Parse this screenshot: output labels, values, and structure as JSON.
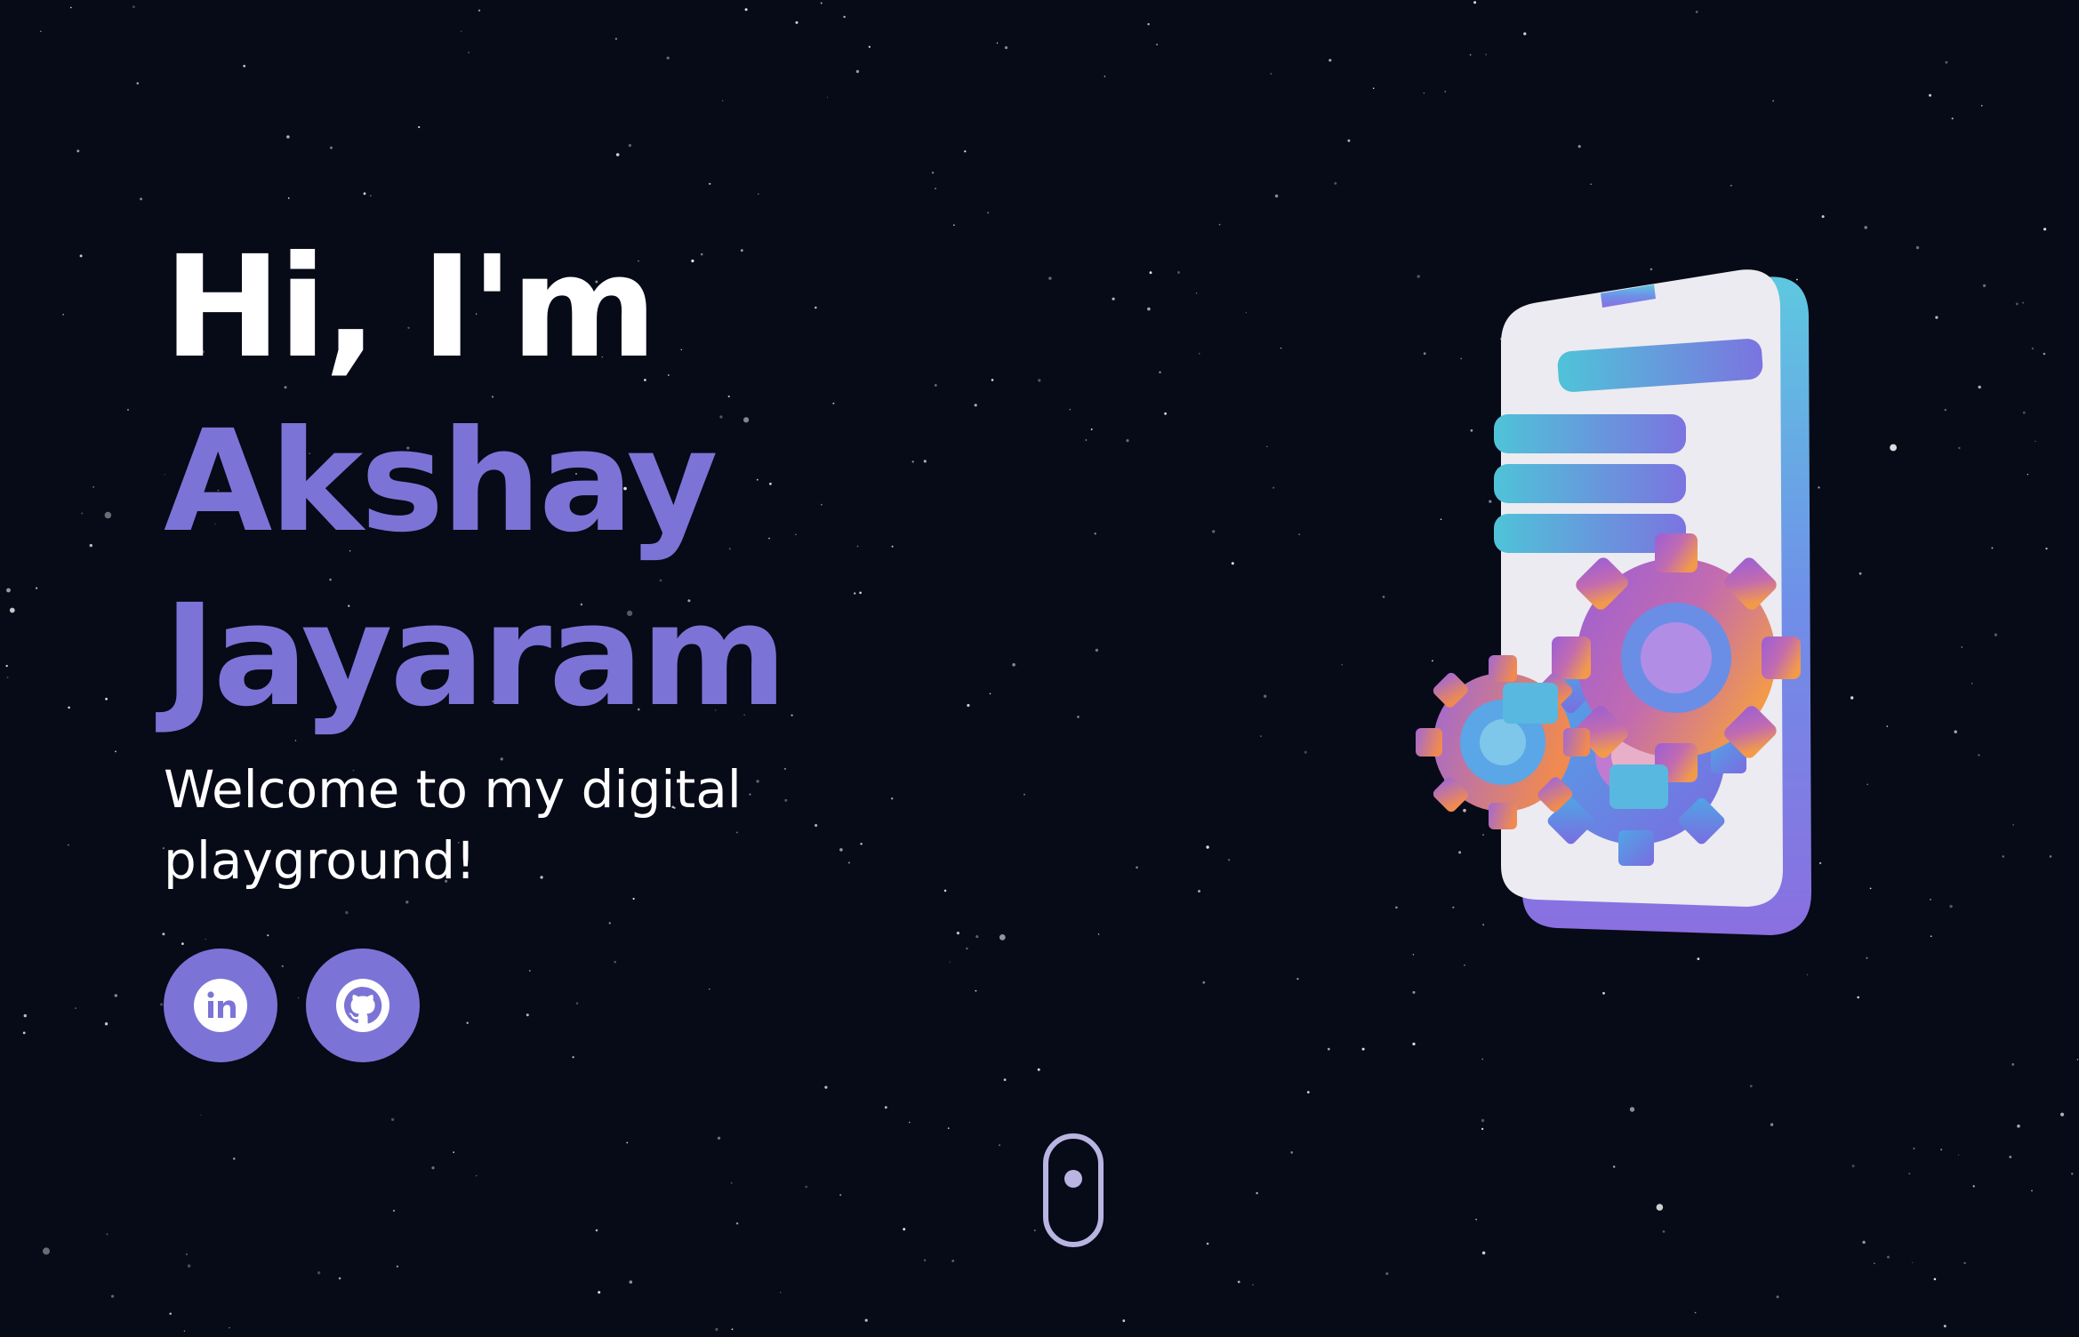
{
  "hero": {
    "greeting": "Hi, I'm",
    "first_name": "Akshay",
    "last_name": "Jayaram",
    "tagline": "Welcome to my digital playground!"
  },
  "socials": [
    {
      "icon": "linkedin-icon"
    },
    {
      "icon": "github-icon"
    }
  ],
  "colors": {
    "background": "#070a17",
    "accent": "#7b74d6",
    "text": "#ffffff",
    "scroll_indicator": "#b9b4e2"
  }
}
